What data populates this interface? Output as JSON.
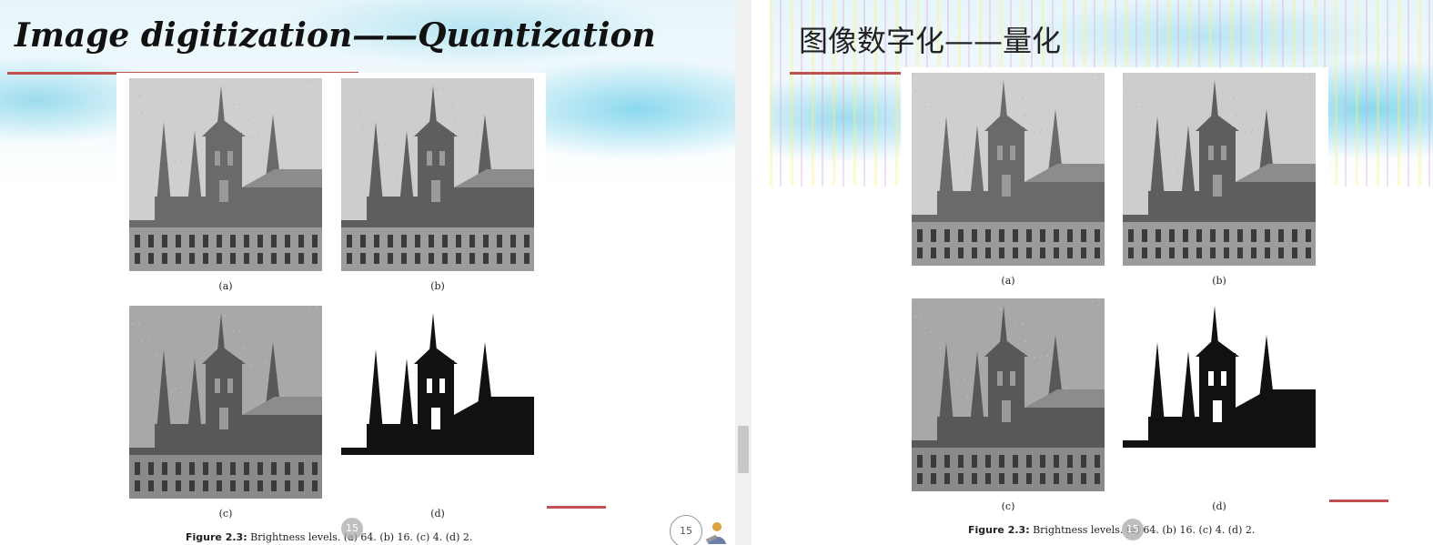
{
  "left_slide": {
    "title": "Image digitization——Quantization",
    "panel_labels": [
      "(a)",
      "(b)",
      "(c)",
      "(d)"
    ],
    "caption_prefix": "Figure 2.3:",
    "caption_text": " Brightness levels. (a) 64. (b) 16. (c) 4. (d) 2.",
    "page_badge": "15",
    "page_number": "15"
  },
  "right_slide": {
    "title": "图像数字化——量化",
    "panel_labels": [
      "(a)",
      "(b)",
      "(c)",
      "(d)"
    ],
    "caption_prefix": "Figure 2.3:",
    "caption_text": " Brightness levels. (a) 64. (b) 16. (c) 4. (d) 2.",
    "page_badge": "15"
  },
  "panels": [
    {
      "label": "(a)",
      "gray_levels": 64,
      "sky": "#cfcfcf",
      "building": "#6a6a6a",
      "ground": "#9a9a9a"
    },
    {
      "label": "(b)",
      "gray_levels": 16,
      "sky": "#cdcdcd",
      "building": "#5e5e5e",
      "ground": "#9c9c9c"
    },
    {
      "label": "(c)",
      "gray_levels": 4,
      "sky": "#a8a8a8",
      "building": "#585858",
      "ground": "#8a8a8a"
    },
    {
      "label": "(d)",
      "gray_levels": 2,
      "sky": "#ffffff",
      "building": "#111111",
      "ground": "#ffffff"
    }
  ],
  "colors": {
    "accent_red": "#c0504d",
    "sky_blue": "#8fd6ea"
  }
}
